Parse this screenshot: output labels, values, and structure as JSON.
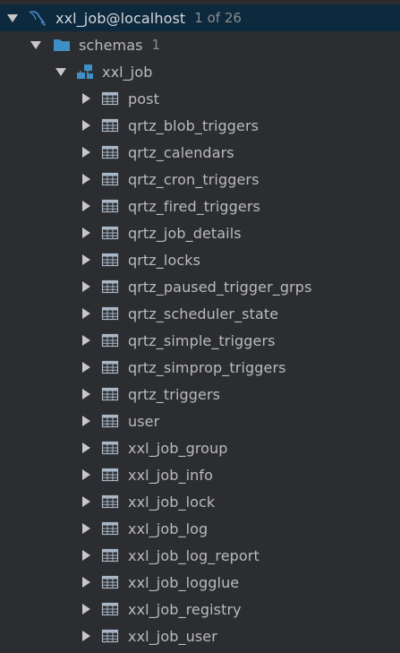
{
  "connection": {
    "label": "xxl_job@localhost",
    "count": "1 of 26",
    "icon": "mysql-dolphin-icon"
  },
  "schemas": {
    "label": "schemas",
    "count": "1",
    "icon": "folder-icon"
  },
  "schema": {
    "label": "xxl_job",
    "icon": "schema-icon"
  },
  "tables": [
    "post",
    "qrtz_blob_triggers",
    "qrtz_calendars",
    "qrtz_cron_triggers",
    "qrtz_fired_triggers",
    "qrtz_job_details",
    "qrtz_locks",
    "qrtz_paused_trigger_grps",
    "qrtz_scheduler_state",
    "qrtz_simple_triggers",
    "qrtz_simprop_triggers",
    "qrtz_triggers",
    "user",
    "xxl_job_group",
    "xxl_job_info",
    "xxl_job_lock",
    "xxl_job_log",
    "xxl_job_log_report",
    "xxl_job_logglue",
    "xxl_job_registry",
    "xxl_job_user"
  ],
  "colors": {
    "background": "#2b2d30",
    "selected_row": "#0d293e",
    "text": "#bbbbbb",
    "count_text": "#8c8c8c",
    "folder": "#3d8fc6",
    "table_icon": "#a9b7c6"
  }
}
